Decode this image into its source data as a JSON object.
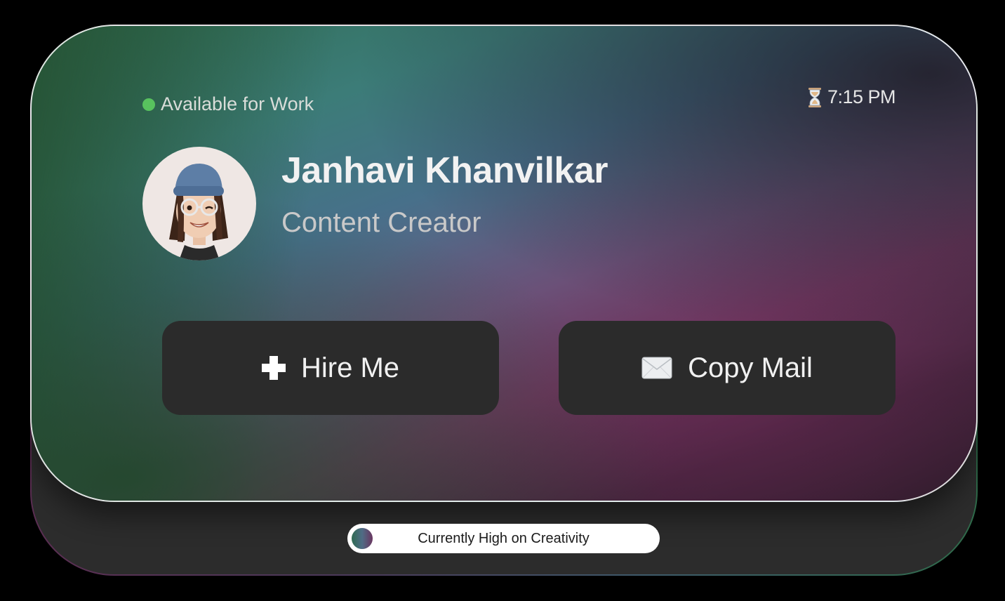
{
  "status": {
    "label": "Available for Work",
    "color": "#58c25e"
  },
  "clock": {
    "icon": "hourglass-icon",
    "time": "7:15 PM"
  },
  "profile": {
    "name": "Janhavi Khanvilkar",
    "role": "Content Creator",
    "avatar": "memoji-avatar"
  },
  "actions": {
    "hire": {
      "icon": "plus-icon",
      "label": "Hire Me"
    },
    "mail": {
      "icon": "envelope-icon",
      "label": "Copy Mail"
    }
  },
  "footer": {
    "mood": "Currently High on Creativity"
  },
  "colors": {
    "accent_green": "#2f6b52",
    "accent_purple": "#6e3b62",
    "button_bg": "#2b2b2b",
    "base_bg": "#2c2c2c"
  }
}
